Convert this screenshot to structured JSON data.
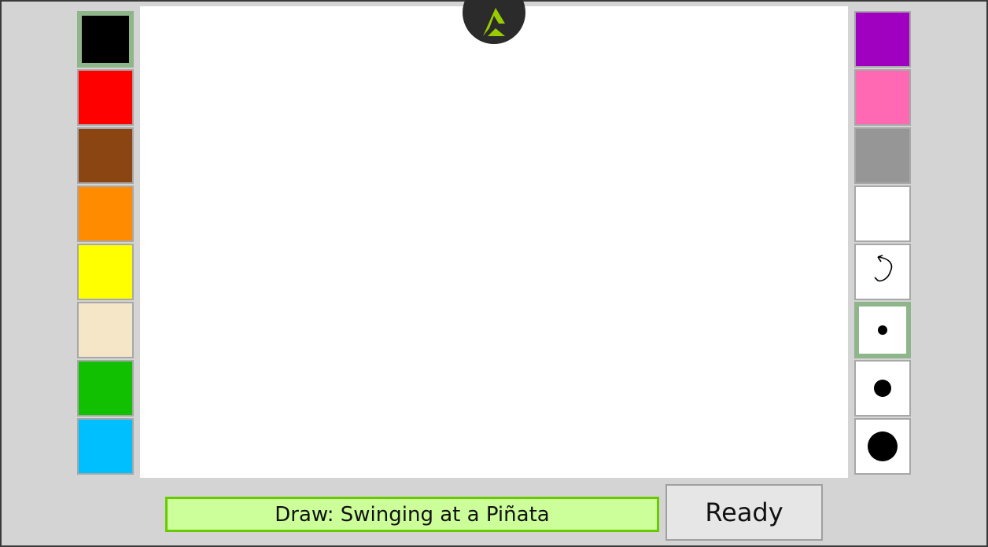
{
  "palette_left": [
    {
      "name": "color-black",
      "color": "#000000",
      "selected": true
    },
    {
      "name": "color-red",
      "color": "#ff0000",
      "selected": false
    },
    {
      "name": "color-brown",
      "color": "#8b4513",
      "selected": false
    },
    {
      "name": "color-orange",
      "color": "#ff8c00",
      "selected": false
    },
    {
      "name": "color-yellow",
      "color": "#ffff00",
      "selected": false
    },
    {
      "name": "color-beige",
      "color": "#f5e6c8",
      "selected": false
    },
    {
      "name": "color-green",
      "color": "#11c000",
      "selected": false
    },
    {
      "name": "color-sky-blue",
      "color": "#00bfff",
      "selected": false
    }
  ],
  "palette_right": [
    {
      "name": "color-purple",
      "color": "#a000c0",
      "selected": false
    },
    {
      "name": "color-pink",
      "color": "#ff69b4",
      "selected": false
    },
    {
      "name": "color-gray",
      "color": "#969696",
      "selected": false
    },
    {
      "name": "color-white",
      "color": "#ffffff",
      "selected": false
    }
  ],
  "tools": [
    {
      "name": "undo-button",
      "icon": "undo-icon",
      "selected": false
    },
    {
      "name": "brush-small-button",
      "icon": "small-dot-icon",
      "selected": true
    },
    {
      "name": "brush-medium-button",
      "icon": "medium-dot-icon",
      "selected": false
    },
    {
      "name": "brush-large-button",
      "icon": "large-dot-icon",
      "selected": false
    }
  ],
  "prompt": {
    "text": "Draw: Swinging at a Piñata"
  },
  "ready_button": {
    "label": "Ready"
  },
  "colors": {
    "background": "#d4d4d4",
    "selection_border": "#8fb58a",
    "prompt_fill": "#ccff99",
    "prompt_border": "#66cc00",
    "logo_green": "#99cc00"
  }
}
